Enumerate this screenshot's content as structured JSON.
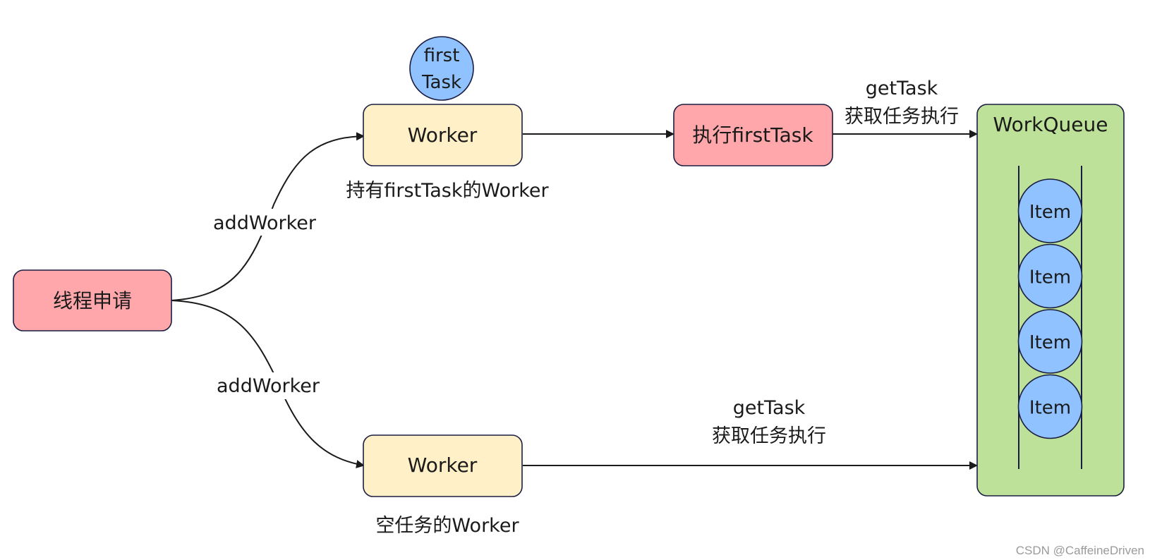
{
  "colors": {
    "red_node": "#ffa7ab",
    "worker_node": "#fff0c8",
    "task_circle": "#90c2ff",
    "queue_fill": "#bde198",
    "node_border": "#1a1d42",
    "edge": "#1a1a1a"
  },
  "nodes": {
    "thread_request": {
      "label": "线程申请"
    },
    "worker_with_task": {
      "label": "Worker",
      "caption": "持有firstTask的Worker"
    },
    "first_task": {
      "line1": "first",
      "line2": "Task"
    },
    "execute_first_task": {
      "label": "执行firstTask"
    },
    "worker_empty": {
      "label": "Worker",
      "caption": "空任务的Worker"
    },
    "work_queue": {
      "label": "WorkQueue",
      "items": [
        "Item",
        "Item",
        "Item",
        "Item"
      ]
    }
  },
  "edges": {
    "add_worker_top": {
      "label": "addWorker"
    },
    "add_worker_bottom": {
      "label": "addWorker"
    },
    "get_task_top": {
      "line1": "getTask",
      "line2": "获取任务执行"
    },
    "get_task_bottom": {
      "line1": "getTask",
      "line2": "获取任务执行"
    }
  },
  "watermark": "CSDN @CaffeineDriven"
}
